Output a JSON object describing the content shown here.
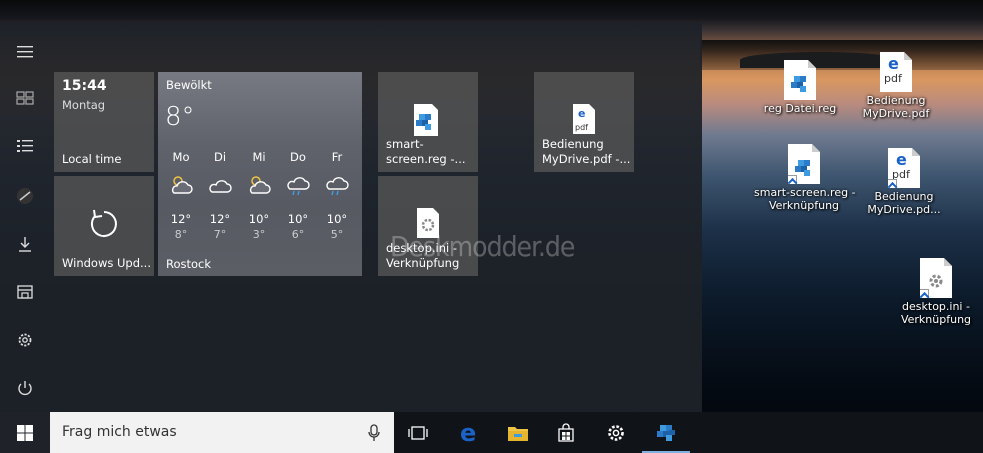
{
  "start": {
    "clock_tile": {
      "time": "15:44",
      "day": "Montag",
      "label": "Local time"
    },
    "update_tile": {
      "label": "Windows Upd..."
    },
    "weather_tile": {
      "condition": "Bewölkt",
      "temp": "8°",
      "city": "Rostock",
      "days": [
        {
          "name": "Mo",
          "hi": "12°",
          "lo": "8°",
          "icon": "sun-cloud-icon"
        },
        {
          "name": "Di",
          "hi": "12°",
          "lo": "7°",
          "icon": "cloud-icon"
        },
        {
          "name": "Mi",
          "hi": "10°",
          "lo": "3°",
          "icon": "sun-cloud-icon"
        },
        {
          "name": "Do",
          "hi": "10°",
          "lo": "6°",
          "icon": "rain-cloud-icon"
        },
        {
          "name": "Fr",
          "hi": "10°",
          "lo": "5°",
          "icon": "rain-cloud-icon"
        }
      ]
    },
    "pinned": [
      {
        "label": "smart-\nscreen.reg -...",
        "icon": "reg-file-icon"
      },
      {
        "label": "Bedienung\nMyDrive.pdf -...",
        "icon": "pdf-icon"
      },
      {
        "label": "desktop.ini -\nVerknüpfung",
        "icon": "ini-file-icon"
      }
    ],
    "watermark": "Deskmodder.de"
  },
  "desktop": {
    "icons": [
      {
        "label": "reg Datei.reg",
        "icon": "reg-file-icon",
        "shortcut": false
      },
      {
        "label": "Bedienung\nMyDrive.pdf",
        "icon": "pdf-icon",
        "shortcut": false
      },
      {
        "label": "smart-screen.reg -\nVerknüpfung",
        "icon": "reg-file-icon",
        "shortcut": true
      },
      {
        "label": "Bedienung\nMyDrive.pd...",
        "icon": "pdf-icon",
        "shortcut": true
      },
      {
        "label": "desktop.ini -\nVerknüpfung",
        "icon": "ini-file-icon",
        "shortcut": true
      }
    ]
  },
  "taskbar": {
    "search_placeholder": "Frag mich etwas"
  },
  "colors": {
    "edge_blue": "#1b62c7",
    "explorer_yellow": "#f0c443",
    "start_bg": "#1e2228",
    "tile_gray": "#585858"
  }
}
